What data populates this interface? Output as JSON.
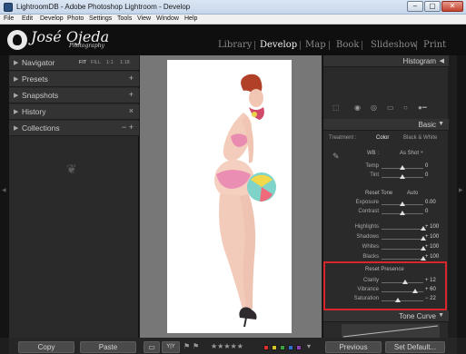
{
  "window": {
    "title": "LightroomDB - Adobe Photoshop Lightroom - Develop",
    "minimize": "–",
    "maximize": "▢",
    "close": "✕"
  },
  "menu": [
    "File",
    "Edit",
    "Develop",
    "Photo",
    "Settings",
    "Tools",
    "View",
    "Window",
    "Help"
  ],
  "identity": {
    "name": "José Ojeda",
    "sub": "Photography"
  },
  "modules": [
    {
      "label": "Library",
      "active": false
    },
    {
      "label": "Develop",
      "active": true
    },
    {
      "label": "Map",
      "active": false
    },
    {
      "label": "Book",
      "active": false
    },
    {
      "label": "Slideshow",
      "active": false
    },
    {
      "label": "Print",
      "active": false
    }
  ],
  "left_panel": {
    "navigator": {
      "label": "Navigator",
      "zoom": [
        "FIT",
        "FILL",
        "1:1",
        "1:18"
      ]
    },
    "items": [
      {
        "label": "Presets",
        "action": "+"
      },
      {
        "label": "Snapshots",
        "action": "+"
      },
      {
        "label": "History",
        "action": "×"
      },
      {
        "label": "Collections",
        "action": "− +"
      }
    ],
    "ornament": "❦"
  },
  "right_panel": {
    "histogram": "Histogram",
    "basic": "Basic",
    "treatment": {
      "label": "Treatment :",
      "options": [
        "Color",
        "Black & White"
      ],
      "selected": "Color"
    },
    "wb": {
      "label": "WB :",
      "value": "As Shot ÷"
    },
    "wb_sliders": [
      {
        "label": "Temp",
        "value": "0",
        "pos": 0.5
      },
      {
        "label": "Tint",
        "value": "0",
        "pos": 0.5
      }
    ],
    "tone": {
      "label": "Reset Tone",
      "auto": "Auto"
    },
    "tone_sliders": [
      {
        "label": "Exposure",
        "value": "0.00",
        "pos": 0.5
      },
      {
        "label": "Contrast",
        "value": "0",
        "pos": 0.5
      }
    ],
    "light_sliders": [
      {
        "label": "Highlights",
        "value": "+ 100",
        "pos": 1.0
      },
      {
        "label": "Shadows",
        "value": "+ 100",
        "pos": 1.0
      },
      {
        "label": "Whites",
        "value": "+ 100",
        "pos": 1.0
      },
      {
        "label": "Blacks",
        "value": "+ 100",
        "pos": 1.0
      }
    ],
    "presence": {
      "label": "Reset Presence"
    },
    "presence_sliders": [
      {
        "label": "Clarity",
        "value": "+ 12",
        "pos": 0.56
      },
      {
        "label": "Vibrance",
        "value": "+ 60",
        "pos": 0.8
      },
      {
        "label": "Saturation",
        "value": "− 22",
        "pos": 0.39
      }
    ],
    "tone_curve": "Tone Curve"
  },
  "bottom": {
    "copy": "Copy",
    "paste": "Paste",
    "view_yy": "Y|Y",
    "stars": "★★★★★",
    "previous": "Previous",
    "set_default": "Set Default..."
  },
  "colors": {
    "accent_highlight": "#d8262c",
    "labels": [
      "#d9302b",
      "#d8c22a",
      "#3aa43a",
      "#2f6fd1",
      "#8c3fb4"
    ]
  }
}
